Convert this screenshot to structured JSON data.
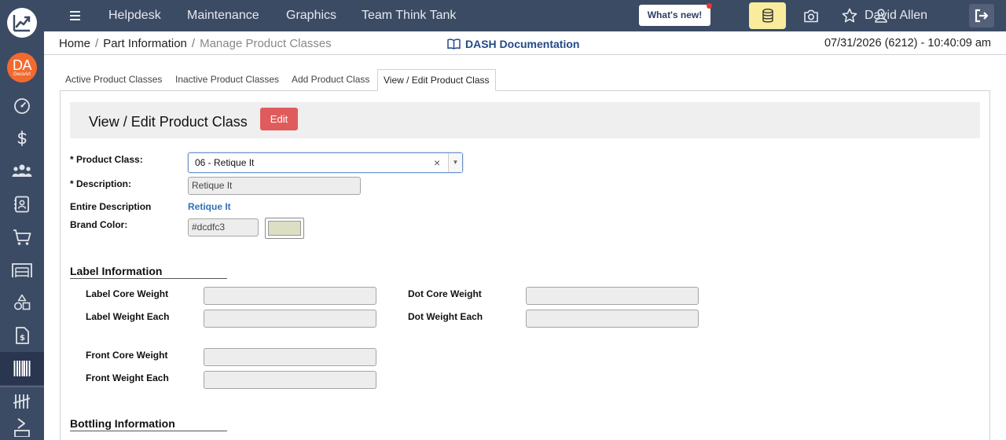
{
  "rail": {
    "avatar_initials": "DA",
    "avatar_sub": "DecoArt",
    "items": [
      "dashboard-icon",
      "dollar-icon",
      "users-icon",
      "contact-card-icon",
      "cart-icon",
      "warehouse-icon",
      "shapes-icon",
      "invoice-icon",
      "barcode-icon",
      "tally-icon",
      "flow-icon"
    ]
  },
  "topbar": {
    "nav": [
      "Helpdesk",
      "Maintenance",
      "Graphics",
      "Team Think Tank"
    ],
    "whats_new": "What's new!",
    "user_name": "David Allen",
    "accent_colors": {
      "bar": "#3c4b64",
      "db_button": "#f9ec9d",
      "whats_new_dot": "#e33333"
    }
  },
  "breadcrumb": {
    "items": [
      "Home",
      "Part Information",
      "Manage Product Classes"
    ],
    "docs_link": "DASH Documentation",
    "datetime": "07/31/2026 (6212) - 10:40:09 am"
  },
  "tabs": [
    "Active Product Classes",
    "Inactive Product Classes",
    "Add Product Class",
    "View / Edit Product Class"
  ],
  "form": {
    "title": "View / Edit Product Class",
    "edit_label": "Edit",
    "product_class": {
      "label": "* Product Class:",
      "value": "06 - Retique It",
      "clear": "×",
      "arrow": "▼"
    },
    "description": {
      "label": "* Description:",
      "value": "Retique It"
    },
    "entire_description": {
      "label": "Entire Description",
      "value": "Retique It"
    },
    "brand_color": {
      "label": "Brand Color:",
      "value": "#dcdfc3"
    }
  },
  "label_info": {
    "heading": "Label Information",
    "fields": {
      "label_core_weight": "Label Core Weight",
      "label_weight_each": "Label Weight Each",
      "dot_core_weight": "Dot Core Weight",
      "dot_weight_each": "Dot Weight Each",
      "front_core_weight": "Front Core Weight",
      "front_weight_each": "Front Weight Each"
    }
  },
  "bottling_info": {
    "heading": "Bottling Information"
  }
}
